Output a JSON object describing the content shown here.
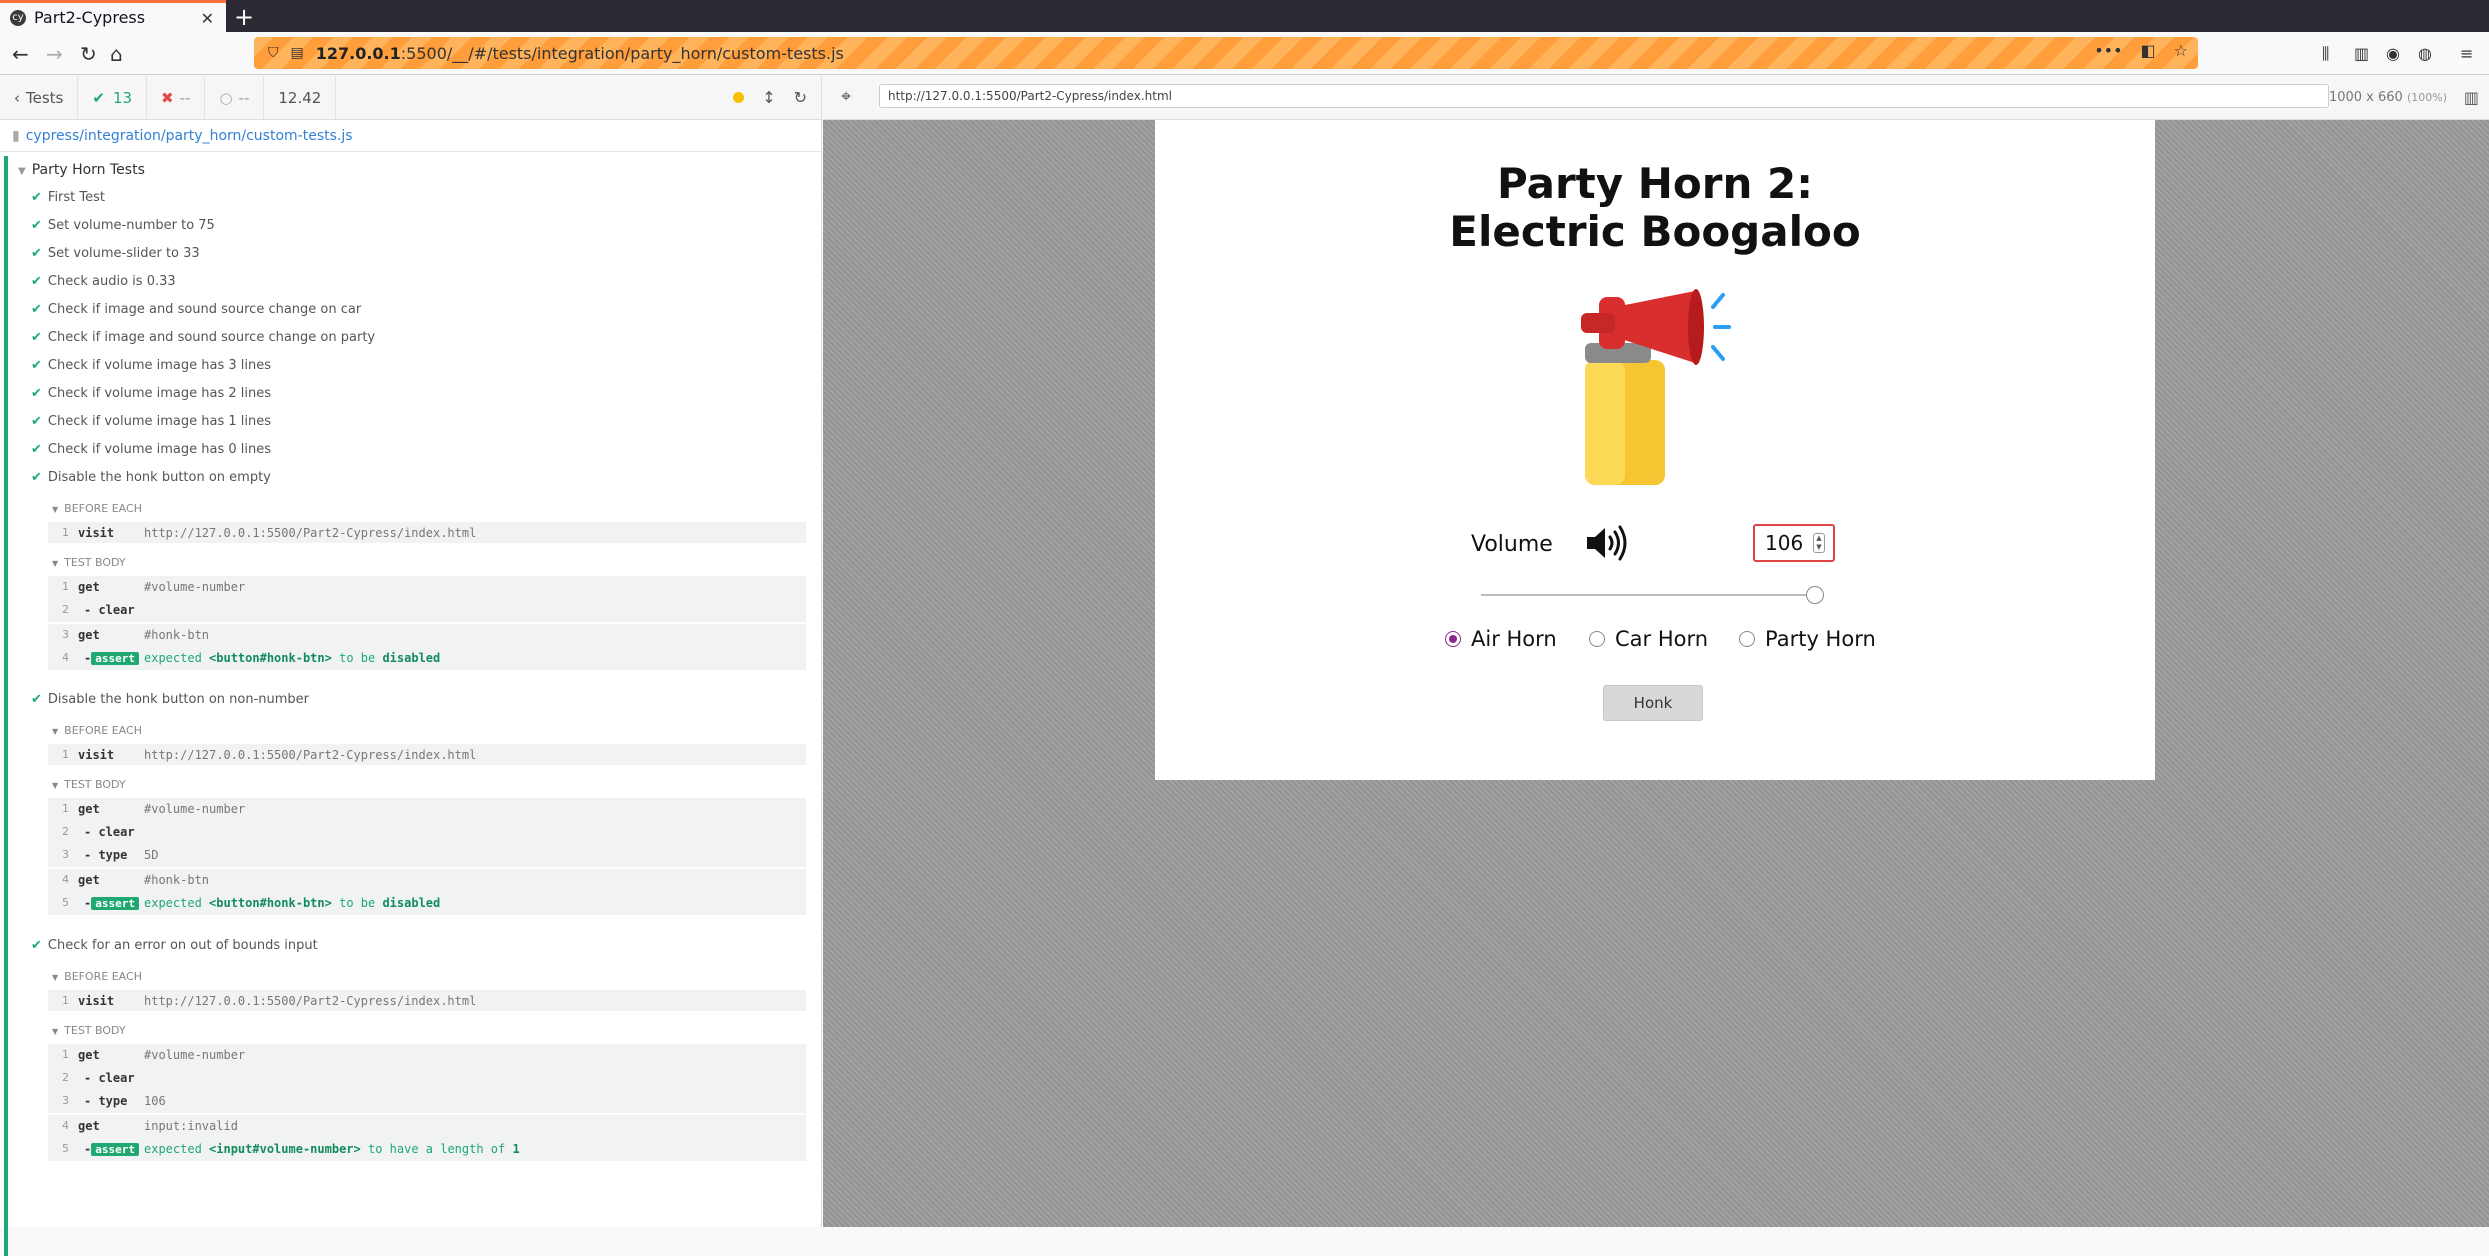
{
  "browser": {
    "tab_title": "Part2-Cypress",
    "tab_favicon": "cypress-icon",
    "url_host": "127.0.0.1",
    "url_rest": ":5500/__/#/tests/integration/party_horn/custom-tests.js"
  },
  "reporter": {
    "back_label": "Tests",
    "passed_count": "13",
    "failed_count": "--",
    "pending_count": "--",
    "duration": "12.42",
    "spec_path": "cypress/integration/party_horn/custom-tests.js",
    "suite_title": "Party Horn Tests",
    "tests": [
      {
        "title": "First Test"
      },
      {
        "title": "Set volume-number to 75"
      },
      {
        "title": "Set volume-slider to 33"
      },
      {
        "title": "Check audio is 0.33"
      },
      {
        "title": "Check if image and sound source change on car"
      },
      {
        "title": "Check if image and sound source change on party"
      },
      {
        "title": "Check if volume image has 3 lines"
      },
      {
        "title": "Check if volume image has 2 lines"
      },
      {
        "title": "Check if volume image has 1 lines"
      },
      {
        "title": "Check if volume image has 0 lines"
      },
      {
        "title": "Disable the honk button on empty"
      },
      {
        "title": "Disable the honk button on non-number"
      },
      {
        "title": "Check for an error on out of bounds input"
      }
    ],
    "hook_before_each": "BEFORE EACH",
    "hook_test_body": "TEST BODY",
    "cmd_visit": "visit",
    "cmd_get": "get",
    "cmd_clear": "- clear",
    "cmd_type": "- type",
    "cmd_dash": "-",
    "cmd_assert": "assert",
    "visit_url": "http://127.0.0.1:5500/Part2-Cypress/index.html",
    "sel_volume_number": "#volume-number",
    "sel_honk_btn": "#honk-btn",
    "sel_invalid": "input:invalid",
    "type_5d": "5D",
    "type_106": "106",
    "assert_expected": "expected",
    "assert_honk_el": "<button#honk-btn>",
    "assert_to_be": "to be",
    "assert_disabled": "disabled",
    "assert_vol_el": "<input#volume-number>",
    "assert_length": "to have a length of",
    "assert_one": "1",
    "nums": [
      "1",
      "2",
      "3",
      "4",
      "5"
    ]
  },
  "aut": {
    "url": "http://127.0.0.1:5500/Part2-Cypress/index.html",
    "size": "1000 x 660",
    "zoom": "(100%)"
  },
  "app": {
    "title_line1": "Party Horn 2:",
    "title_line2": "Electric Boogaloo",
    "volume_label": "Volume",
    "volume_value": "106",
    "slider_level_percent": 100,
    "radios": [
      "Air Horn",
      "Car Horn",
      "Party Horn"
    ],
    "selected_radio": "Air Horn",
    "honk_label": "Honk"
  }
}
